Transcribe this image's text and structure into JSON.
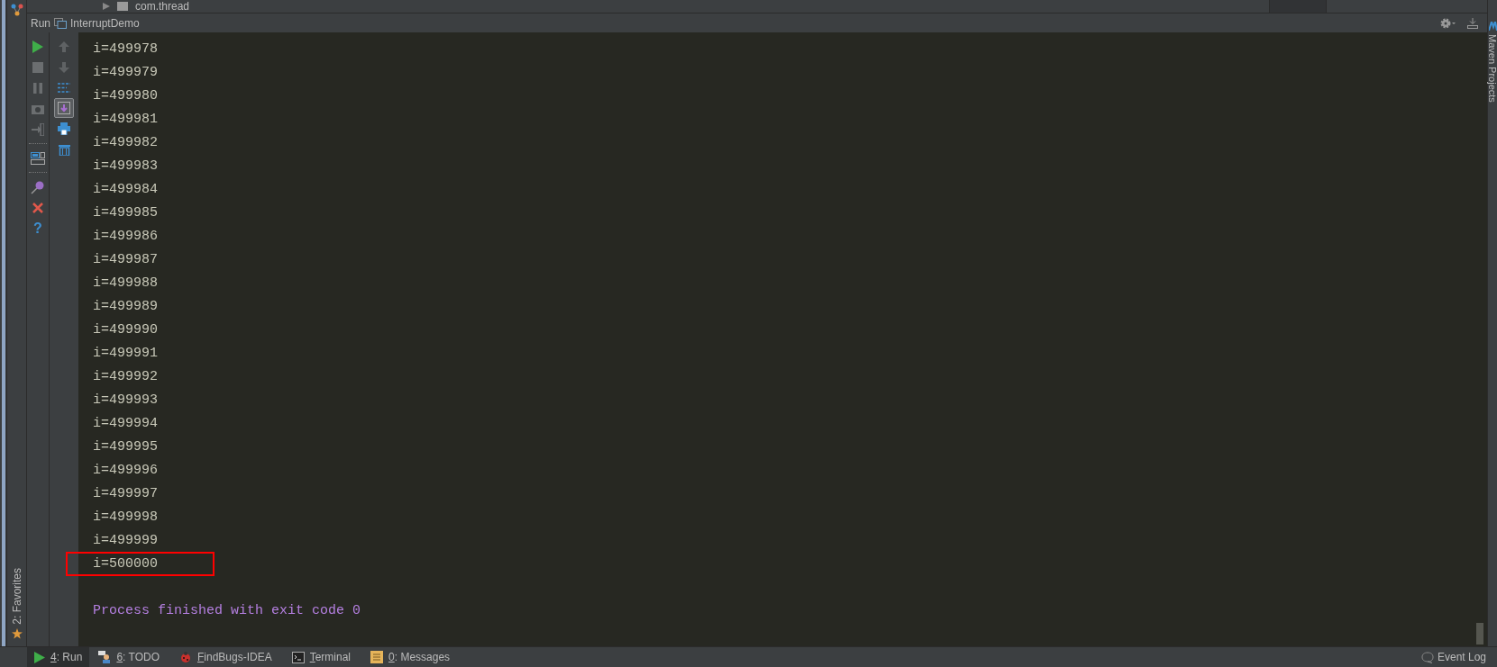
{
  "project_tree": {
    "item": "com.thread"
  },
  "run_panel": {
    "title": "Run",
    "config": "InterruptDemo"
  },
  "side_tools": {
    "left": "2: Favorites",
    "right": "Maven Projects"
  },
  "toolbar_main": [
    {
      "kind": "run",
      "disabled": false
    },
    {
      "kind": "stop",
      "disabled": true
    },
    {
      "kind": "pause",
      "disabled": true
    },
    {
      "kind": "camera",
      "disabled": true
    },
    {
      "kind": "exit",
      "disabled": true
    },
    {
      "kind": "sep"
    },
    {
      "kind": "layout",
      "disabled": false
    },
    {
      "kind": "sep"
    },
    {
      "kind": "pin",
      "disabled": false
    },
    {
      "kind": "close",
      "disabled": false
    },
    {
      "kind": "help",
      "disabled": false,
      "glyph": "?"
    }
  ],
  "toolbar_side": [
    {
      "kind": "up",
      "selected": false,
      "disabled": true
    },
    {
      "kind": "down",
      "selected": false,
      "disabled": true
    },
    {
      "kind": "wrap",
      "selected": false,
      "disabled": false
    },
    {
      "kind": "scroll",
      "selected": true,
      "disabled": false
    },
    {
      "kind": "print",
      "selected": false,
      "disabled": false
    },
    {
      "kind": "trash",
      "selected": false,
      "disabled": false
    }
  ],
  "console": [
    {
      "text": "i=499978",
      "highlighted": false
    },
    {
      "text": "i=499979",
      "highlighted": false
    },
    {
      "text": "i=499980",
      "highlighted": false
    },
    {
      "text": "i=499981",
      "highlighted": false
    },
    {
      "text": "i=499982",
      "highlighted": false
    },
    {
      "text": "i=499983",
      "highlighted": false
    },
    {
      "text": "i=499984",
      "highlighted": false
    },
    {
      "text": "i=499985",
      "highlighted": false
    },
    {
      "text": "i=499986",
      "highlighted": false
    },
    {
      "text": "i=499987",
      "highlighted": false
    },
    {
      "text": "i=499988",
      "highlighted": false
    },
    {
      "text": "i=499989",
      "highlighted": false
    },
    {
      "text": "i=499990",
      "highlighted": false
    },
    {
      "text": "i=499991",
      "highlighted": false
    },
    {
      "text": "i=499992",
      "highlighted": false
    },
    {
      "text": "i=499993",
      "highlighted": false
    },
    {
      "text": "i=499994",
      "highlighted": false
    },
    {
      "text": "i=499995",
      "highlighted": false
    },
    {
      "text": "i=499996",
      "highlighted": false
    },
    {
      "text": "i=499997",
      "highlighted": false
    },
    {
      "text": "i=499998",
      "highlighted": false
    },
    {
      "text": "i=499999",
      "highlighted": false
    },
    {
      "text": "i=500000",
      "highlighted": true
    }
  ],
  "exit_message": "Process finished with exit code 0",
  "bottom_tabs": [
    {
      "label": "4: Run",
      "selected": true
    },
    {
      "label": "6: TODO",
      "selected": false
    },
    {
      "label": "FindBugs-IDEA",
      "selected": false
    },
    {
      "label": "Terminal",
      "selected": false
    },
    {
      "label": "0: Messages",
      "selected": false
    }
  ],
  "event_log": "Event Log"
}
